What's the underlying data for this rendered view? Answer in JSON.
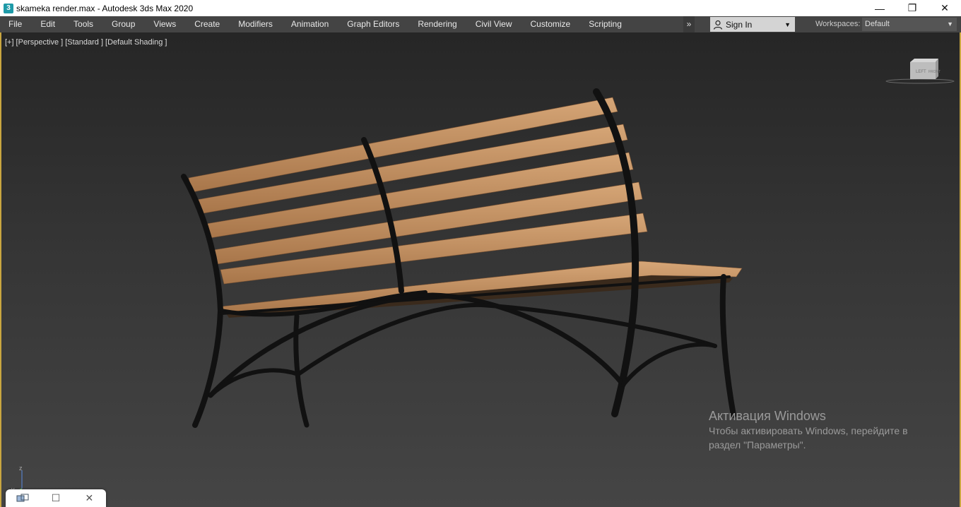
{
  "titlebar": {
    "app_icon_letter": "3",
    "title": "skameka render.max - Autodesk 3ds Max 2020",
    "minimize": "—",
    "maximize": "❐",
    "close": "✕"
  },
  "menubar": {
    "items": [
      "File",
      "Edit",
      "Tools",
      "Group",
      "Views",
      "Create",
      "Modifiers",
      "Animation",
      "Graph Editors",
      "Rendering",
      "Civil View",
      "Customize",
      "Scripting"
    ],
    "overflow": "»",
    "signin_label": "Sign In",
    "workspaces_label": "Workspaces:",
    "workspace_value": "Default"
  },
  "viewport": {
    "label_parts": [
      "[+]",
      "[Perspective ]",
      "[Standard ]",
      "[Default Shading ]"
    ],
    "viewcube_left": "LEFT",
    "viewcube_front": "FRONT",
    "axis_z": "z",
    "axis_y": "y"
  },
  "activation": {
    "title": "Активация Windows",
    "line1": "Чтобы активировать Windows, перейдите в",
    "line2": "раздел \"Параметры\"."
  },
  "colors": {
    "wood": "#c99a6a",
    "metal": "#111111",
    "menubar": "#444444",
    "viewport_border": "#c9a640"
  }
}
